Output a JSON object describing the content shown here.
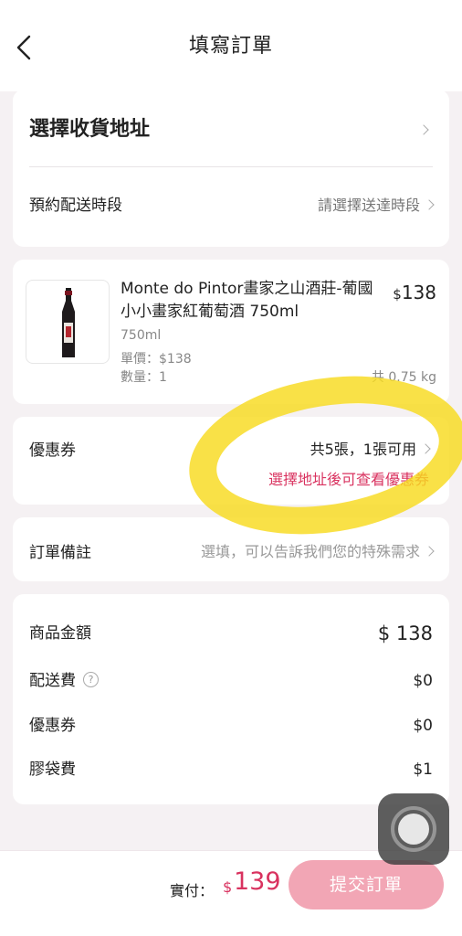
{
  "header": {
    "title": "填寫訂單"
  },
  "address": {
    "label": "選擇收貨地址"
  },
  "delivery": {
    "label": "預約配送時段",
    "value": "請選擇送達時段"
  },
  "product": {
    "name": "Monte do Pintor畫家之山酒莊-葡國 小小畫家紅葡萄酒 750ml",
    "price_currency": "$",
    "price_value": "138",
    "size": "750ml",
    "unit_price": "單價：$138",
    "quantity": "數量：1",
    "weight": "共 0.75 kg"
  },
  "coupon": {
    "label": "優惠券",
    "count": "共5張，1張可用",
    "note": "選擇地址後可查看優惠券"
  },
  "remarks": {
    "label": "訂單備註",
    "placeholder": "選填，可以告訴我們您的特殊需求"
  },
  "summary": {
    "goods_label": "商品金額",
    "goods_value": "$ 138",
    "shipping_label": "配送費",
    "shipping_value": "$0",
    "coupon_label": "優惠券",
    "coupon_value": "$0",
    "bag_label": "膠袋費",
    "bag_value": "$1"
  },
  "footer": {
    "pay_label": "實付：",
    "pay_currency": "$",
    "pay_amount": "139",
    "submit_label": "提交訂單"
  },
  "colors": {
    "accent": "#d9325f",
    "submit_button": "#f2a6b5",
    "highlight": "#f8da1e",
    "background": "#f5f1f3"
  },
  "icons": [
    "back-arrow-icon",
    "chevron-right-icon",
    "help-icon",
    "wine-bottle-image",
    "assistive-touch-icon"
  ]
}
